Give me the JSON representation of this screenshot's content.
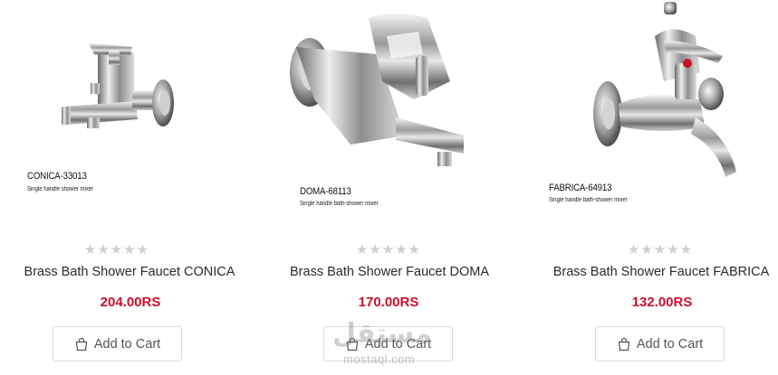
{
  "products": [
    {
      "image": {
        "model": "CONICA-33013",
        "description": "Single handle shower mixer"
      },
      "rating": {
        "stars_filled": 0,
        "stars_total": 5,
        "symbols": [
          "★",
          "★",
          "★",
          "★",
          "★"
        ]
      },
      "title": "Brass Bath Shower Faucet CONICA",
      "price": "204.00RS",
      "add_to_cart_label": "Add to Cart"
    },
    {
      "image": {
        "model": "DOMA-68113",
        "description": "Single handle bath-shower mixer"
      },
      "rating": {
        "stars_filled": 0,
        "stars_total": 5,
        "symbols": [
          "★",
          "★",
          "★",
          "★",
          "★"
        ]
      },
      "title": "Brass Bath Shower Faucet DOMA",
      "price": "170.00RS",
      "add_to_cart_label": "Add to Cart"
    },
    {
      "image": {
        "model": "FABRICA-64913",
        "description": "Single handle bath-shower mixer"
      },
      "rating": {
        "stars_filled": 0,
        "stars_total": 5,
        "symbols": [
          "★",
          "★",
          "★",
          "★",
          "★"
        ]
      },
      "title": "Brass Bath Shower Faucet FABRICA",
      "price": "132.00RS",
      "add_to_cart_label": "Add to Cart"
    }
  ],
  "watermark": {
    "arabic": "مستقل",
    "latin": "mostaql.com"
  },
  "colors": {
    "price": "#c8102e",
    "star_empty": "#cfcfcf",
    "button_border": "#d8d8d8"
  },
  "icons": {
    "cart": "shopping-bag-icon",
    "star": "star-icon"
  }
}
